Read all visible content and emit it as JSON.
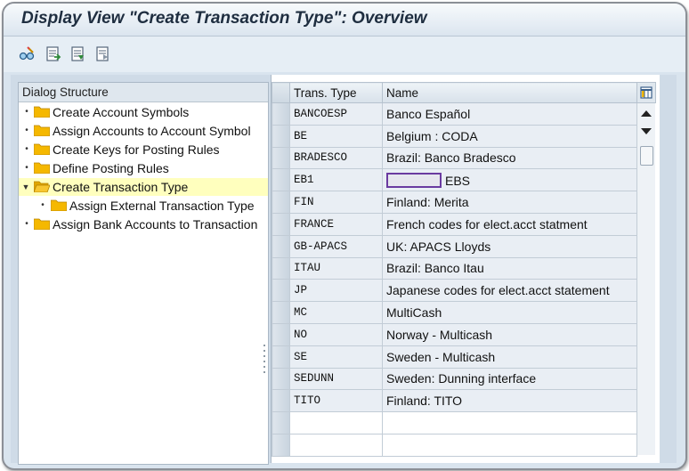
{
  "window": {
    "title": "Display View \"Create Transaction Type\": Overview"
  },
  "toolbar": {
    "buttons": [
      {
        "icon": "glasses-change-icon"
      },
      {
        "icon": "details-icon"
      },
      {
        "icon": "previous-entry-icon"
      },
      {
        "icon": "next-entry-icon"
      }
    ]
  },
  "dialog_structure": {
    "header": "Dialog Structure",
    "items": [
      {
        "label": "Create Account Symbols",
        "level": 0,
        "selected": false,
        "open": false
      },
      {
        "label": "Assign Accounts to Account Symbol",
        "level": 0,
        "selected": false,
        "open": false
      },
      {
        "label": "Create Keys for Posting Rules",
        "level": 0,
        "selected": false,
        "open": false
      },
      {
        "label": "Define Posting Rules",
        "level": 0,
        "selected": false,
        "open": false
      },
      {
        "label": "Create Transaction Type",
        "level": 0,
        "selected": true,
        "open": true
      },
      {
        "label": "Assign External Transaction Type",
        "level": 1,
        "selected": false,
        "open": false
      },
      {
        "label": "Assign Bank Accounts to Transaction",
        "level": 0,
        "selected": false,
        "open": false
      }
    ]
  },
  "table": {
    "columns": [
      "Trans. Type",
      "Name"
    ],
    "rows": [
      {
        "code": "BANCOESP",
        "name": "Banco Español"
      },
      {
        "code": "BE",
        "name": "Belgium : CODA"
      },
      {
        "code": "BRADESCO",
        "name": "Brazil: Banco Bradesco"
      },
      {
        "code": "EB1",
        "name": "EBS",
        "redacted_prefix": true
      },
      {
        "code": "FIN",
        "name": "Finland: Merita"
      },
      {
        "code": "FRANCE",
        "name": "French codes for elect.acct statment"
      },
      {
        "code": "GB-APACS",
        "name": "UK: APACS Lloyds"
      },
      {
        "code": "ITAU",
        "name": "Brazil: Banco Itau"
      },
      {
        "code": "JP",
        "name": "Japanese codes for elect.acct statement"
      },
      {
        "code": "MC",
        "name": "MultiCash"
      },
      {
        "code": "NO",
        "name": "Norway - Multicash"
      },
      {
        "code": "SE",
        "name": "Sweden - Multicash"
      },
      {
        "code": "SEDUNN",
        "name": "Sweden: Dunning interface"
      },
      {
        "code": "TITO",
        "name": "Finland: TITO"
      }
    ],
    "empty_rows": 2
  },
  "colors": {
    "selected_tree_bg": "#ffffbe",
    "folder": "#f5b800",
    "redaction_border": "#6a3aa0"
  }
}
